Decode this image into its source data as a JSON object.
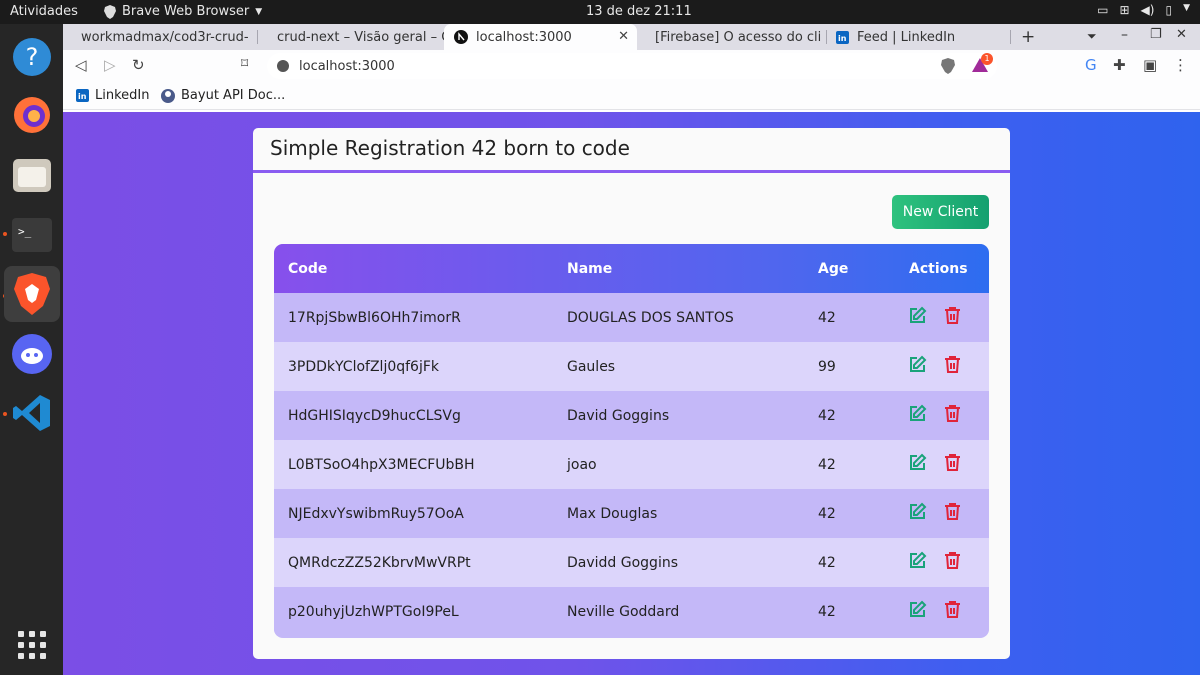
{
  "system": {
    "activities": "Atividades",
    "app_menu": "Brave Web Browser",
    "clock": "13 de dez  21:11"
  },
  "tabs": [
    {
      "label": "workmadmax/cod3r-crud-",
      "icon": "github-icon"
    },
    {
      "label": "crud-next – Visão geral – C",
      "icon": "firebase-icon"
    },
    {
      "label": "localhost:3000",
      "icon": "nextjs-icon",
      "active": true
    },
    {
      "label": "[Firebase] O acesso do clie",
      "icon": "gmail-icon"
    },
    {
      "label": "Feed | LinkedIn",
      "icon": "linkedin-icon"
    }
  ],
  "address": {
    "url": "localhost:3000"
  },
  "bookmarks": [
    {
      "label": "LinkedIn",
      "icon": "linkedin-icon"
    },
    {
      "label": "Bayut API Doc...",
      "icon": "bayut-icon"
    }
  ],
  "app": {
    "title": "Simple Registration 42 born to code",
    "new_client_label": "New Client",
    "columns": {
      "code": "Code",
      "name": "Name",
      "age": "Age",
      "actions": "Actions"
    },
    "rows": [
      {
        "code": "17RpjSbwBl6OHh7imorR",
        "name": "DOUGLAS DOS SANTOS",
        "age": "42"
      },
      {
        "code": "3PDDkYClofZlj0qf6jFk",
        "name": "Gaules",
        "age": "99"
      },
      {
        "code": "HdGHISIqycD9hucCLSVg",
        "name": "David Goggins",
        "age": "42"
      },
      {
        "code": "L0BTSoO4hpX3MECFUbBH",
        "name": "joao",
        "age": "42"
      },
      {
        "code": "NJEdxvYswibmRuy57OoA",
        "name": "Max Douglas",
        "age": "42"
      },
      {
        "code": "QMRdczZZ52KbrvMwVRPt",
        "name": "Davidd Goggins",
        "age": "42"
      },
      {
        "code": "p20uhyjUzhWPTGoI9PeL",
        "name": "Neville Goddard",
        "age": "42"
      }
    ]
  },
  "colors": {
    "edit": "#1aa37a",
    "delete": "#e0243a",
    "accent": "#8a5cf1"
  }
}
